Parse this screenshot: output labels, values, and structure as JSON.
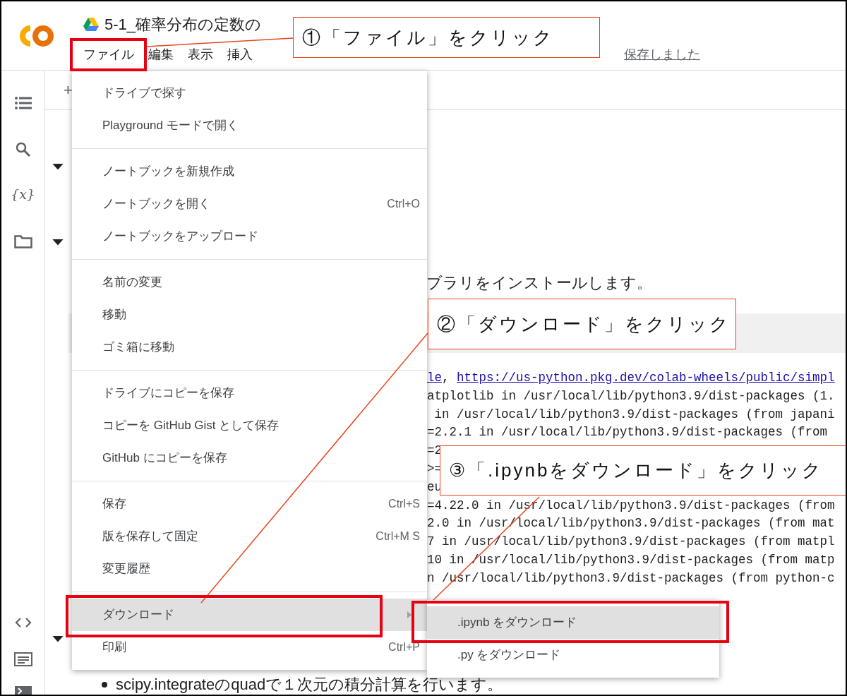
{
  "app": {
    "title": "5-1_確率分布の定数の",
    "menu_bar": [
      {
        "label": "ファイル"
      },
      {
        "label": "編集"
      },
      {
        "label": "表示"
      },
      {
        "label": "挿入"
      }
    ],
    "save_status": "保存しました"
  },
  "sidebar": {
    "variables_label": "{x}"
  },
  "toolbar": {
    "add_label": "+"
  },
  "file_menu": [
    [
      {
        "label": "ドライブで探す",
        "selected": false
      },
      {
        "label": "Playground モードで開く",
        "selected": false
      }
    ],
    [
      {
        "label": "ノートブックを新規作成",
        "selected": false
      },
      {
        "label": "ノートブックを開く",
        "shortcut": "Ctrl+O",
        "selected": false
      },
      {
        "label": "ノートブックをアップロード",
        "selected": false
      }
    ],
    [
      {
        "label": "名前の変更",
        "selected": false
      },
      {
        "label": "移動",
        "selected": false
      },
      {
        "label": "ゴミ箱に移動",
        "selected": false
      }
    ],
    [
      {
        "label": "ドライブにコピーを保存",
        "selected": false
      },
      {
        "label": "コピーを GitHub Gist として保存",
        "selected": false
      },
      {
        "label": "GitHub にコピーを保存",
        "selected": false
      }
    ],
    [
      {
        "label": "保存",
        "shortcut": "Ctrl+S",
        "selected": false
      },
      {
        "label": "版を保存して固定",
        "shortcut": "Ctrl+M S",
        "selected": false
      },
      {
        "label": "変更履歴",
        "selected": false
      }
    ],
    [
      {
        "label": "ダウンロード",
        "selected": true,
        "submenu": true
      },
      {
        "label": "印刷",
        "shortcut": "Ctrl+P",
        "selected": false
      }
    ]
  ],
  "download_submenu": [
    {
      "label": ".ipynb をダウンロード",
      "selected": true
    },
    {
      "label": ".py をダウンロード",
      "selected": false
    }
  ],
  "notebook": {
    "text_fragment": "ブラリをインストールします。",
    "output_first": {
      "prefix": "le",
      "separator": ", ",
      "link": "https://us-python.pkg.dev/colab-wheels/public/simpl"
    },
    "output_lines": [
      "atplotlib in /usr/local/lib/python3.9/dist-packages (1.",
      " in /usr/local/lib/python3.9/dist-packages (from japani",
      "=2.2.1 in /usr/local/lib/python3.9/dist-packages (from ",
      "=2",
      ">=",
      "eu",
      "=4.22.0 in /usr/local/lib/python3.9/dist-packages (from",
      "2.0 in /usr/local/lib/python3.9/dist-packages (from mat",
      "7 in /usr/local/lib/python3.9/dist-packages (from matpl",
      "10 in /usr/local/lib/python3.9/dist-packages (from matp",
      "n /usr/local/lib/python3.9/dist-packages (from python-c"
    ],
    "bullet": "scipy.integrateのquadで１次元の積分計算を行います。"
  },
  "callouts": [
    "①「ファイル」をクリック",
    "②「ダウンロード」をクリック",
    "③「.ipynbをダウンロード」をクリック"
  ]
}
